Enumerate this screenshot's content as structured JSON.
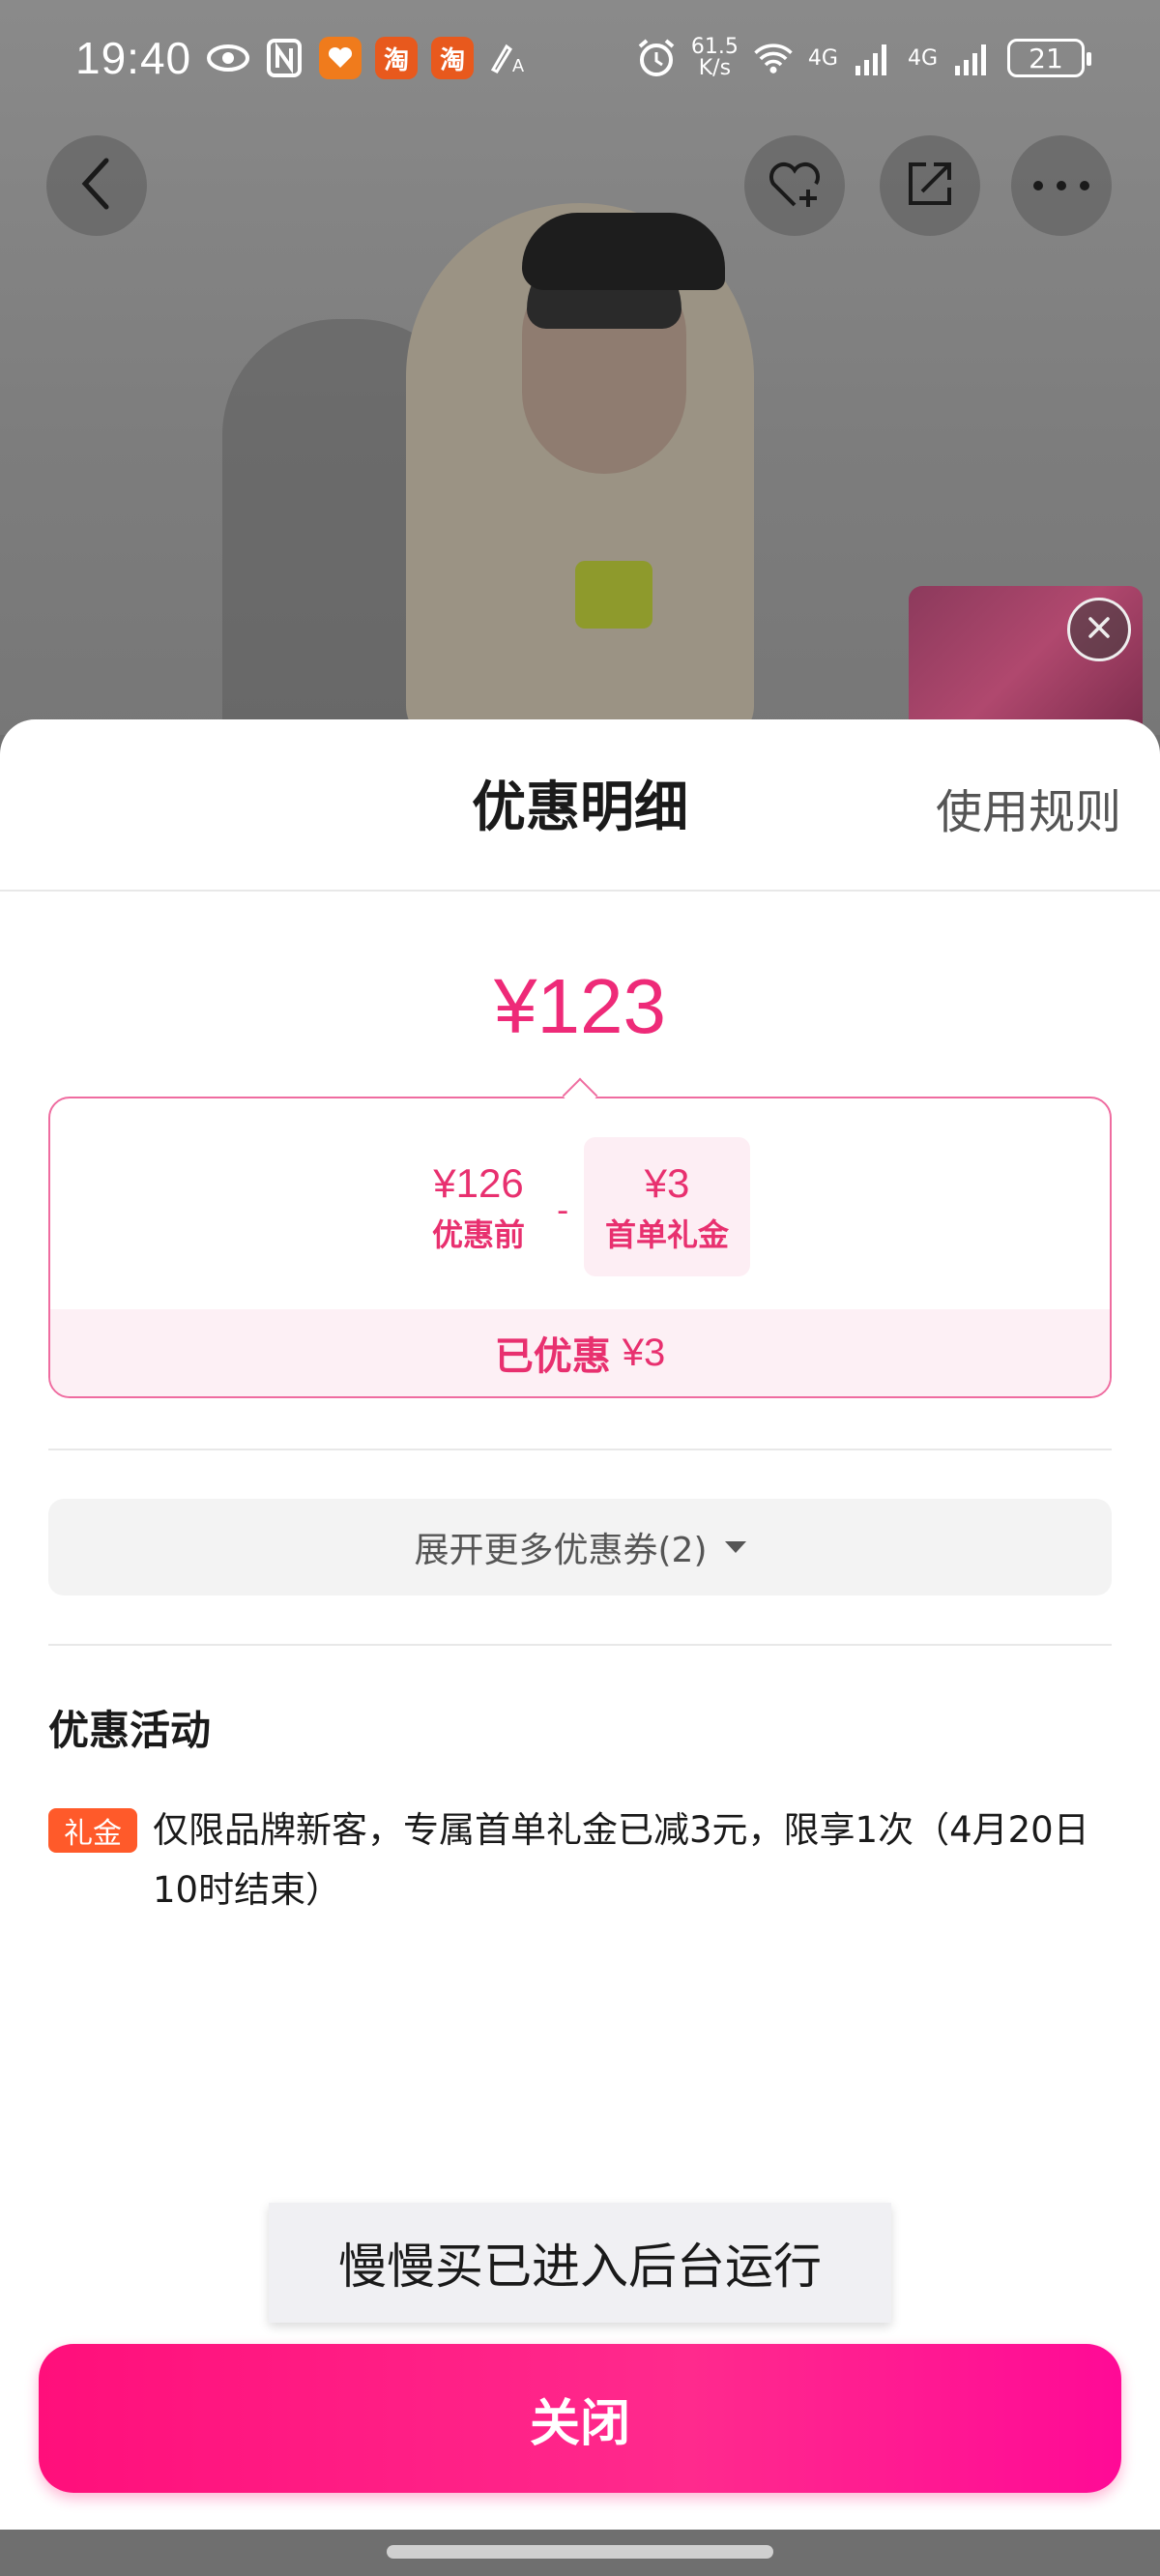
{
  "status_bar": {
    "time": "19:40",
    "net_speed_value": "61.5",
    "net_speed_unit": "K/s",
    "signal1": "4G",
    "signal2": "4G",
    "battery": "21",
    "app_icon_1": "淘",
    "app_icon_2": "淘"
  },
  "sheet": {
    "title": "优惠明细",
    "rules_link": "使用规则",
    "total_price": "¥123",
    "breakdown": {
      "original_value": "¥126",
      "original_label": "优惠前",
      "discount_value": "¥3",
      "discount_label": "首单礼金",
      "operator": "-"
    },
    "saved_label": "已优惠",
    "saved_amount": "¥3",
    "expand_button": "展开更多优惠券(2)",
    "activities_title": "优惠活动",
    "gift_tag": "礼金",
    "activity_text": "仅限品牌新客，专属首单礼金已减3元，限享1次（4月20日10时结束）",
    "close_button": "关闭"
  },
  "toast": "慢慢买已进入后台运行",
  "colors": {
    "accent": "#ee2a78",
    "gift_tag": "#ff5a2a",
    "close_button": "#ff1a85"
  },
  "icons": [
    "eye-icon",
    "nfc-icon",
    "heart-app-icon",
    "alarm-icon",
    "wifi-icon",
    "signal-icon",
    "battery-icon",
    "back-icon",
    "favorite-add-icon",
    "share-icon",
    "more-icon",
    "close-circle-icon",
    "caret-down-icon"
  ]
}
